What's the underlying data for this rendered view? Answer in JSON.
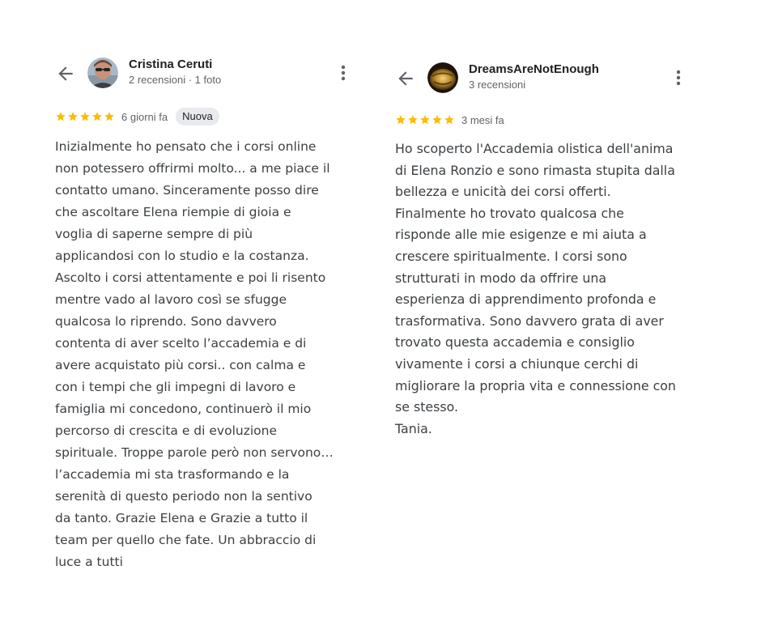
{
  "reviews": [
    {
      "reviewer_name": "Cristina Ceruti",
      "reviewer_meta": "2 recensioni · 1 foto",
      "rating": 5,
      "time_ago": "6 giorni fa",
      "badge": "Nuova",
      "text": "Inizialmente ho pensato che i corsi online\nnon potessero offrirmi molto... a me piace il\ncontatto umano. Sinceramente posso dire\nche ascoltare Elena riempie di gioia e\nvoglia di saperne sempre di più\napplicandosi con lo studio e la costanza.\nAscolto i corsi attentamente e poi li risento\nmentre vado al lavoro così se sfugge\nqualcosa lo riprendo. Sono davvero\ncontenta di aver scelto l’accademia e di\navere acquistato più corsi.. con calma e\ncon i tempi che gli impegni di lavoro e\nfamiglia mi concedono, continuerò il mio\npercorso di crescita e di evoluzione\nspirituale. Troppe parole però non servono…\nl’accademia mi sta trasformando e la\nserenità di questo periodo non la sentivo\nda tanto. Grazie Elena e Grazie a tutto il\nteam per quello che fate. Un abbraccio di\nluce a tutti"
    },
    {
      "reviewer_name": "DreamsAreNotEnough",
      "reviewer_meta": "3 recensioni",
      "rating": 5,
      "time_ago": "3 mesi fa",
      "text": "Ho scoperto l'Accademia olistica dell'anima\ndi Elena Ronzio e sono rimasta stupita dalla\nbellezza e unicità dei corsi offerti.\nFinalmente ho trovato qualcosa che\nrisponde alle mie esigenze e mi aiuta a\ncrescere spiritualmente. I corsi sono\nstrutturati in modo da offrire una\nesperienza di apprendimento profonda e\ntrasformativa. Sono davvero grata di aver\ntrovato questa accademia e consiglio\nvivamente i corsi a chiunque cerchi di\nmigliorare la propria vita e connessione con\nse stesso.\nTania."
    }
  ],
  "colors": {
    "star": "#fbbc04",
    "icon": "#5f6368",
    "text": "#3c4043",
    "badge_bg": "#e8eaed"
  },
  "icons": {
    "back": "arrow-left-icon",
    "more": "more-vertical-icon",
    "star": "star-icon"
  }
}
